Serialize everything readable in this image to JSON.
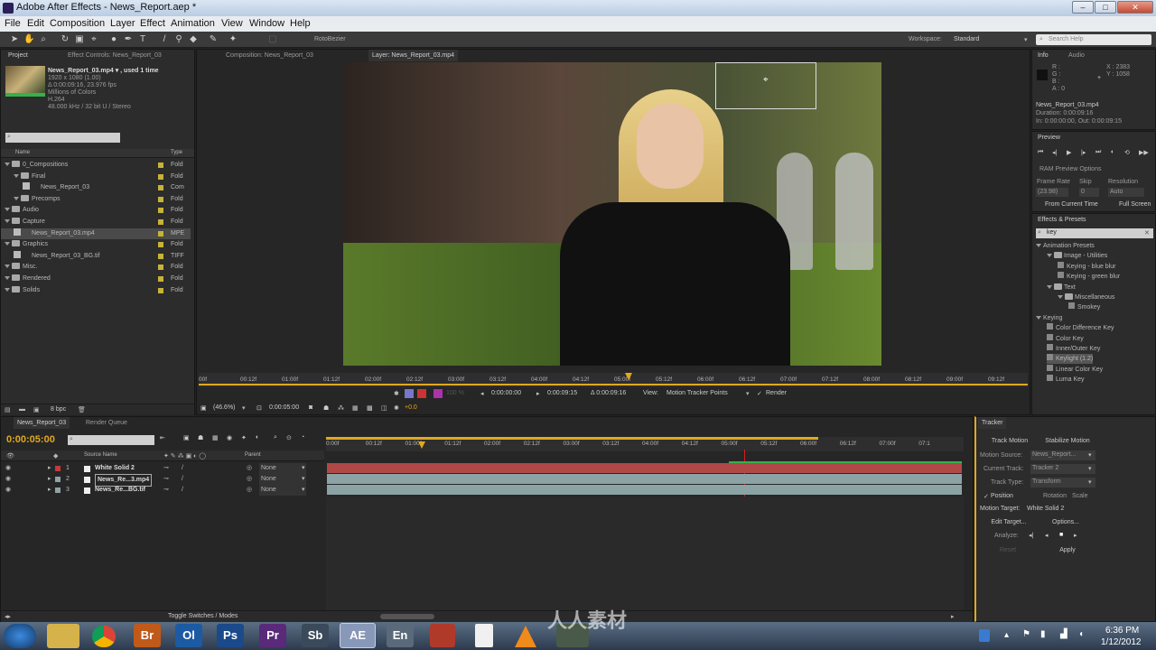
{
  "window": {
    "title": "Adobe After Effects - News_Report.aep *",
    "min": "–",
    "max": "□",
    "close": "✕"
  },
  "menu": [
    "File",
    "Edit",
    "Composition",
    "Layer",
    "Effect",
    "Animation",
    "View",
    "Window",
    "Help"
  ],
  "toolbar": {
    "rotobezier": "RotoBezier",
    "workspace_label": "Workspace:",
    "workspace_value": "Standard",
    "search_placeholder": "Search Help"
  },
  "project": {
    "tab_project": "Project",
    "tab_effect_controls": "Effect Controls: News_Report_03",
    "filename": "News_Report_03.mp4 ▾ , used 1 time",
    "res": "1920 x 1080 (1.00)",
    "dur": "Δ 0:00:09:16, 23.976 fps",
    "colors": "Millions of Colors",
    "codec": "H.264",
    "audio": "48.000 kHz / 32 bit U / Stereo",
    "col_name": "Name",
    "col_type": "Type",
    "bpc": "8 bpc",
    "items": [
      {
        "name": "0_Compositions",
        "type": "Fold",
        "indent": 0
      },
      {
        "name": "Final",
        "type": "Fold",
        "indent": 1
      },
      {
        "name": "News_Report_03",
        "type": "Com",
        "indent": 2
      },
      {
        "name": "Precomps",
        "type": "Fold",
        "indent": 1
      },
      {
        "name": "Audio",
        "type": "Fold",
        "indent": 0
      },
      {
        "name": "Capture",
        "type": "Fold",
        "indent": 0
      },
      {
        "name": "News_Report_03.mp4",
        "type": "MPE",
        "indent": 1
      },
      {
        "name": "Graphics",
        "type": "Fold",
        "indent": 0
      },
      {
        "name": "News_Report_03_BG.tif",
        "type": "TIFF",
        "indent": 1
      },
      {
        "name": "Misc.",
        "type": "Fold",
        "indent": 0
      },
      {
        "name": "Rendered",
        "type": "Fold",
        "indent": 0
      },
      {
        "name": "Solids",
        "type": "Fold",
        "indent": 0
      }
    ]
  },
  "viewer": {
    "tab_comp": "Composition: News_Report_03",
    "tab_layer": "Layer: News_Report_03.mp4",
    "ruler": [
      "00f",
      "00:12f",
      "01:00f",
      "01:12f",
      "02:00f",
      "02:12f",
      "03:00f",
      "03:12f",
      "04:00f",
      "04:12f",
      "05:00f",
      "05:12f",
      "06:00f",
      "06:12f",
      "07:00f",
      "07:12f",
      "08:00f",
      "08:12f",
      "09:00f",
      "09:12f"
    ],
    "in": "0:00:00:00",
    "out": "0:00:09:15",
    "dur": "Δ 0:00:09:16",
    "view_label": "View:",
    "view_value": "Motion Tracker Points",
    "render": "Render",
    "zoom": "(46.6%)",
    "time": "0:00:05:00",
    "offset": "+0.0",
    "pct": "100 %"
  },
  "info": {
    "tab_info": "Info",
    "tab_audio": "Audio",
    "r": "R :",
    "g": "G :",
    "b": "B :",
    "a": "A : 0",
    "x": "X : 2383",
    "y": "Y : 1058",
    "file": "News_Report_03.mp4",
    "duration": "Duration: 0:00:09:16",
    "inout": "In: 0:00:00:00, Out: 0:00:09:15"
  },
  "preview": {
    "tab": "Preview",
    "ram": "RAM Preview Options",
    "fr_label": "Frame Rate",
    "skip_label": "Skip",
    "res_label": "Resolution",
    "fr": "(23.98)",
    "skip": "0",
    "res": "Auto",
    "from": "From Current Time",
    "full": "Full Screen"
  },
  "effects": {
    "tab": "Effects & Presets",
    "search": "key",
    "items": [
      {
        "t": "Animation Presets",
        "i": 0
      },
      {
        "t": "Image - Utilities",
        "i": 1
      },
      {
        "t": "Keying - blue blur",
        "i": 2
      },
      {
        "t": "Keying - green blur",
        "i": 2
      },
      {
        "t": "Text",
        "i": 1
      },
      {
        "t": "Miscellaneous",
        "i": 2
      },
      {
        "t": "Smokey",
        "i": 3
      },
      {
        "t": "Keying",
        "i": 0
      },
      {
        "t": "Color Difference Key",
        "i": 1
      },
      {
        "t": "Color Key",
        "i": 1
      },
      {
        "t": "Inner/Outer Key",
        "i": 1
      },
      {
        "t": "Keylight (1.2)",
        "i": 1
      },
      {
        "t": "Linear Color Key",
        "i": 1
      },
      {
        "t": "Luma Key",
        "i": 1
      }
    ]
  },
  "timeline": {
    "tab_comp": "News_Report_03",
    "tab_queue": "Render Queue",
    "time": "0:00:05:00",
    "col_source": "Source Name",
    "col_parent": "Parent",
    "toggle": "Toggle Switches / Modes",
    "ruler": [
      "0:00f",
      "00:12f",
      "01:00f",
      "01:12f",
      "02:00f",
      "02:12f",
      "03:00f",
      "03:12f",
      "04:00f",
      "04:12f",
      "05:00f",
      "05:12f",
      "06:00f",
      "06:12f",
      "07:00f",
      "07:1"
    ],
    "layers": [
      {
        "num": "1",
        "name": "White Solid 2",
        "parent": "None",
        "color": "#c43a3a"
      },
      {
        "num": "2",
        "name": "News_Re...3.mp4",
        "parent": "None",
        "color": "#8fa3a6"
      },
      {
        "num": "3",
        "name": "News_Re...BG.tif",
        "parent": "None",
        "color": "#8fa3a6"
      }
    ]
  },
  "tracker": {
    "tab": "Tracker",
    "track_motion": "Track Motion",
    "stabilize": "Stabilize Motion",
    "source_label": "Motion Source:",
    "source": "News_Report...",
    "current_label": "Current Track:",
    "current": "Tracker 2",
    "type_label": "Track Type:",
    "type": "Transform",
    "position": "Position",
    "rotation": "Rotation",
    "scale": "Scale",
    "target_label": "Motion Target:",
    "target": "White Solid 2",
    "edit_target": "Edit Target...",
    "options": "Options...",
    "analyze": "Analyze:",
    "reset": "Reset",
    "apply": "Apply"
  },
  "taskbar": {
    "time": "6:36 PM",
    "date": "1/12/2012",
    "apps": [
      "Ol",
      "Ps",
      "Pr",
      "Sb",
      "AE",
      "En"
    ]
  },
  "watermark": "人人素材"
}
